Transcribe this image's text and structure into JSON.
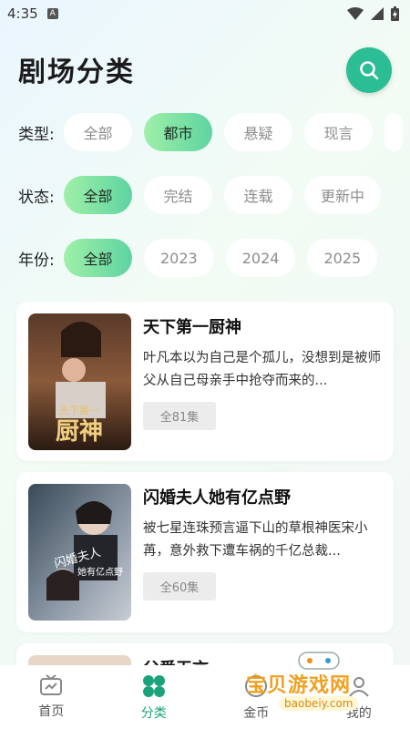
{
  "status_bar": {
    "time": "4:35",
    "notif": "A"
  },
  "header": {
    "title": "剧场分类"
  },
  "filters": [
    {
      "label": "类型:",
      "options": [
        "全部",
        "都市",
        "悬疑",
        "现言"
      ],
      "selected": "都市"
    },
    {
      "label": "状态:",
      "options": [
        "全部",
        "完结",
        "连载",
        "更新中"
      ],
      "selected": "全部"
    },
    {
      "label": "年份:",
      "options": [
        "全部",
        "2023",
        "2024",
        "2025"
      ],
      "selected": "全部"
    }
  ],
  "dramas": [
    {
      "title": "天下第一厨神",
      "desc": "叶凡本以为自己是个孤儿，没想到是被师父从自己母亲手中抢夺而来的...",
      "episodes": "全81集",
      "poster_text": "天下第一厨神"
    },
    {
      "title": "闪婚夫人她有亿点野",
      "desc": "被七星连珠预言逼下山的草根神医宋小苒，意外救下遭车祸的千亿总裁...",
      "episodes": "全60集",
      "poster_text": "闪婚夫人她有亿点野"
    },
    {
      "title": "父爱无言"
    }
  ],
  "tabbar": [
    {
      "label": "首页",
      "icon": "tv-icon"
    },
    {
      "label": "分类",
      "icon": "category-grid-icon"
    },
    {
      "label": "金币",
      "icon": "coin-icon"
    },
    {
      "label": "我的",
      "icon": "profile-icon"
    }
  ],
  "watermark": {
    "title": "宝贝游戏网",
    "url": "baobeiy.com"
  },
  "colors": {
    "accent": "#2bbd93",
    "chip_active_start": "#9ef0a8",
    "chip_active_end": "#5fd3a2"
  }
}
